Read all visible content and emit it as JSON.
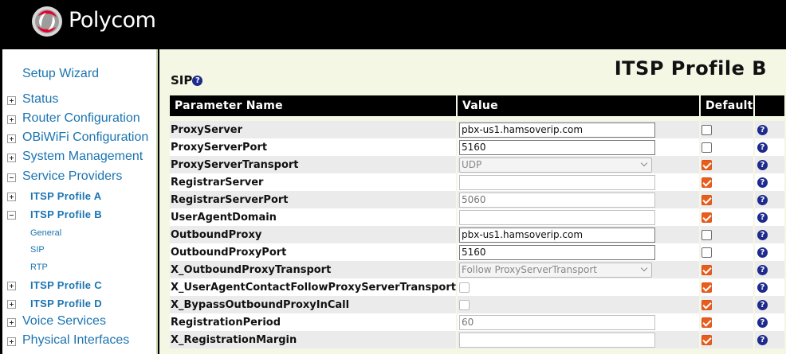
{
  "brand": {
    "name": "Polycom"
  },
  "sidebar": {
    "setup_wizard": "Setup Wizard",
    "status": "Status",
    "router_configuration": "Router Configuration",
    "obiwifi_configuration": "OBiWiFi Configuration",
    "system_management": "System Management",
    "service_providers": "Service Providers",
    "itsp_profile_a": "ITSP Profile A",
    "itsp_profile_b": "ITSP Profile B",
    "general": "General",
    "sip": "SIP",
    "rtp": "RTP",
    "itsp_profile_c": "ITSP Profile C",
    "itsp_profile_d": "ITSP Profile D",
    "voice_services": "Voice Services",
    "physical_interfaces": "Physical Interfaces"
  },
  "main": {
    "page_title": "ITSP Profile B",
    "section_title": "SIP",
    "help_glyph": "?",
    "columns": {
      "name": "Parameter Name",
      "value": "Value",
      "default": "Default"
    },
    "rows": [
      {
        "name": "ProxyServer",
        "type": "text",
        "value": "pbx-us1.hamsoverip.com",
        "default": false
      },
      {
        "name": "ProxyServerPort",
        "type": "text",
        "value": "5160",
        "default": false
      },
      {
        "name": "ProxyServerTransport",
        "type": "select",
        "value": "UDP",
        "default": true
      },
      {
        "name": "RegistrarServer",
        "type": "text",
        "value": "",
        "default": true
      },
      {
        "name": "RegistrarServerPort",
        "type": "text",
        "value": "5060",
        "default": true
      },
      {
        "name": "UserAgentDomain",
        "type": "text",
        "value": "",
        "default": true
      },
      {
        "name": "OutboundProxy",
        "type": "text",
        "value": "pbx-us1.hamsoverip.com",
        "default": false
      },
      {
        "name": "OutboundProxyPort",
        "type": "text",
        "value": "5160",
        "default": false
      },
      {
        "name": "X_OutboundProxyTransport",
        "type": "select",
        "value": "Follow ProxyServerTransport",
        "default": true
      },
      {
        "name": "X_UserAgentContactFollowProxyServerTransport",
        "type": "checkbox",
        "value": false,
        "default": true
      },
      {
        "name": "X_BypassOutboundProxyInCall",
        "type": "checkbox",
        "value": false,
        "default": true
      },
      {
        "name": "RegistrationPeriod",
        "type": "text",
        "value": "60",
        "default": true
      },
      {
        "name": "X_RegistrationMargin",
        "type": "text",
        "value": "",
        "default": true
      }
    ]
  },
  "colors": {
    "header_bg": "#000000",
    "link": "#1b74b1",
    "panel_bg": "#f3f7e4",
    "checkbox_on": "#e85d1c",
    "help_icon": "#1e2a8c"
  }
}
